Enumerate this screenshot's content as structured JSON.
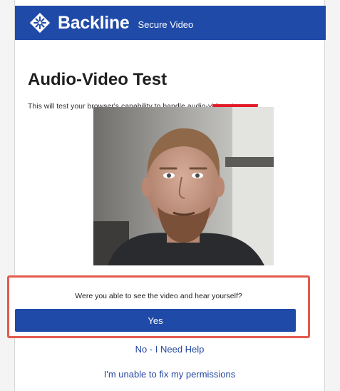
{
  "header": {
    "brand": "Backline",
    "subtitle": "Secure Video",
    "logo_icon": "backline-snowflake-icon",
    "background_color": "#1f4aa8"
  },
  "main": {
    "title": "Audio-Video Test",
    "description": "This will test your browser's capability to handle audio-video streams."
  },
  "prompt": {
    "question": "Were you able to see the video and hear yourself?",
    "yes_label": "Yes",
    "highlight_color": "#e35b4c"
  },
  "links": {
    "need_help": "No - I Need Help",
    "unable_permissions": "I'm unable to fix my permissions"
  },
  "colors": {
    "accent": "#1f4aa8",
    "link": "#2346a0",
    "alert_red": "#e11d2a"
  }
}
